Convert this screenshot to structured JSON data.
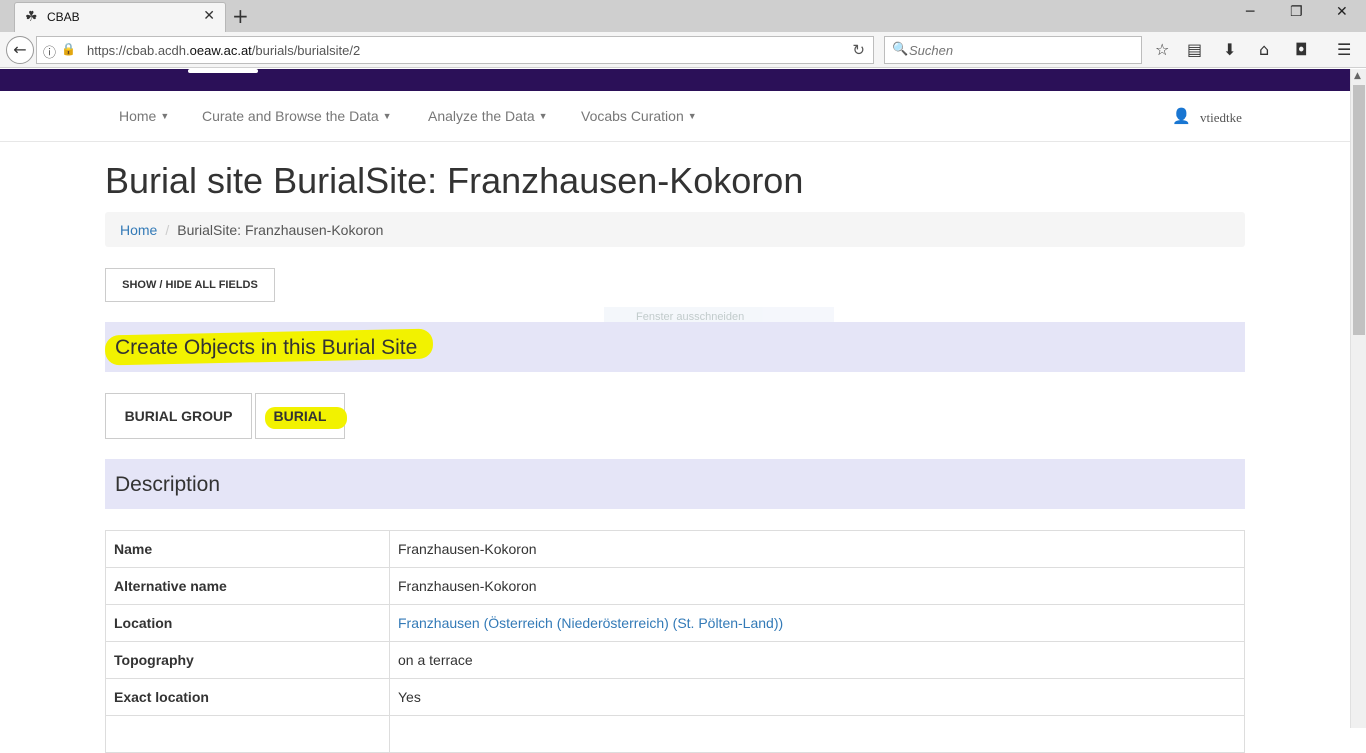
{
  "browser": {
    "tab_title": "CBAB",
    "url_prefix": "https://cbab.acdh.",
    "url_domain": "oeaw.ac.at",
    "url_path": "/burials/burialsite/2",
    "search_placeholder": "Suchen"
  },
  "nav": {
    "items": [
      {
        "label": "Home"
      },
      {
        "label": "Curate and Browse the Data"
      },
      {
        "label": "Analyze the Data"
      },
      {
        "label": "Vocabs Curation"
      }
    ],
    "user": "vtiedtke"
  },
  "page": {
    "title": "Burial site BurialSite: Franzhausen-Kokoron",
    "breadcrumb": {
      "home": "Home",
      "sep": "/",
      "current": "BurialSite: Franzhausen-Kokoron"
    },
    "show_hide_label": "SHOW / HIDE ALL FIELDS",
    "ghost_tooltip": "Fenster ausschneiden"
  },
  "create_section": {
    "title": "Create Objects in this Burial Site",
    "buttons": [
      {
        "label": "BURIAL GROUP"
      },
      {
        "label": "BURIAL"
      }
    ]
  },
  "description": {
    "title": "Description",
    "rows": [
      {
        "label": "Name",
        "value": "Franzhausen-Kokoron"
      },
      {
        "label": "Alternative name",
        "value": "Franzhausen-Kokoron"
      },
      {
        "label": "Location",
        "value": "Franzhausen (Österreich (Niederösterreich) (St. Pölten-Land))"
      },
      {
        "label": "Topography",
        "value": "on a terrace"
      },
      {
        "label": "Exact location",
        "value": "Yes"
      },
      {
        "label": "",
        "value": ""
      }
    ]
  },
  "colors": {
    "header_purple": "#2b1058",
    "section_bg": "#e5e5f7",
    "link_blue": "#337ab7",
    "highlight_yellow": "#f2f200"
  }
}
